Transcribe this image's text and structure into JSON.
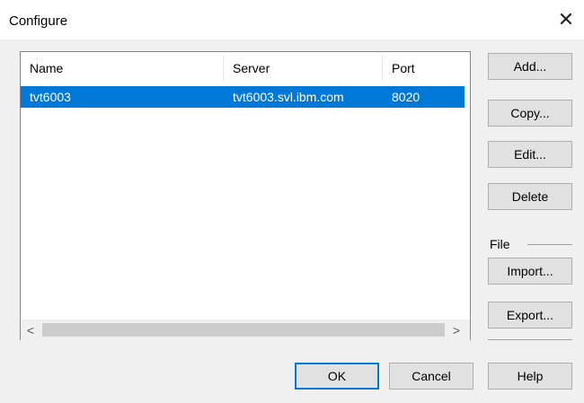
{
  "window": {
    "title": "Configure",
    "close_glyph": "✕"
  },
  "list": {
    "columns": [
      "Name",
      "Server",
      "Port"
    ],
    "rows": [
      {
        "name": "tvt6003",
        "server": "tvt6003.svl.ibm.com",
        "port": "8020",
        "selected": true
      }
    ],
    "scroll_left": "<",
    "scroll_right": ">"
  },
  "side_buttons": {
    "add": "Add...",
    "copy": "Copy...",
    "edit": "Edit...",
    "delete": "Delete",
    "file_label": "File",
    "import": "Import...",
    "export": "Export..."
  },
  "footer": {
    "ok": "OK",
    "cancel": "Cancel",
    "help": "Help"
  },
  "colors": {
    "selection": "#0078d7",
    "dialog_bg": "#f0f0f0",
    "button_bg": "#e1e1e1"
  }
}
